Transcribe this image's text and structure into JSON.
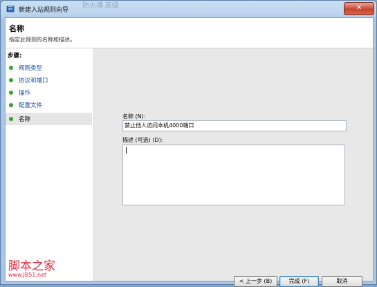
{
  "window": {
    "title": "新建入站规则向导",
    "ghost_text": "防火墙 高级",
    "close_glyph": "✕"
  },
  "header": {
    "title": "名称",
    "description": "指定此规则的名称和描述。"
  },
  "sidebar": {
    "steps_label": "步骤:",
    "items": [
      {
        "label": "规则类型"
      },
      {
        "label": "协议和端口"
      },
      {
        "label": "操作"
      },
      {
        "label": "配置文件"
      },
      {
        "label": "名称",
        "current": true
      }
    ]
  },
  "form": {
    "name_label": "名称 (N):",
    "name_value": "禁止他人访问本机4000端口",
    "desc_label": "描述 (可选) (D):",
    "desc_value": ""
  },
  "buttons": {
    "back": "< 上一步 (B)",
    "finish": "完成 (F)",
    "cancel": "取消"
  },
  "watermark": {
    "text": "脚本之家",
    "url": "www.JB51.net"
  },
  "colors": {
    "step_dot": "#37a132",
    "step_link": "#1c4fa5",
    "watermark": "#e0253d"
  }
}
